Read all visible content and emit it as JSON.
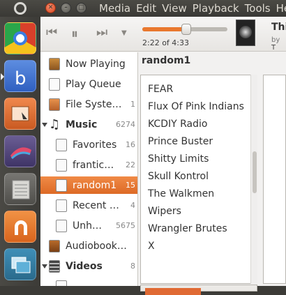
{
  "menu": [
    "Media",
    "Edit",
    "View",
    "Playback",
    "Tools",
    "Help"
  ],
  "player": {
    "time": "2:22 of 4:33",
    "progress": 0.52,
    "now_title": "Thi",
    "now_by_prefix": "by",
    "now_artist": "T"
  },
  "sidebar": [
    {
      "label": "Now Playing",
      "count": "",
      "icon": "now-playing-icon"
    },
    {
      "label": "Play Queue",
      "count": "",
      "icon": "play-queue-icon"
    },
    {
      "label": "File Syste…",
      "count": "1",
      "icon": "file-system-icon"
    },
    {
      "label": "Music",
      "count": "6274",
      "icon": "music-note-icon",
      "header": true
    },
    {
      "label": "Favorites",
      "count": "16",
      "icon": "smart-playlist-icon"
    },
    {
      "label": "frantic…",
      "count": "22",
      "icon": "playlist-icon"
    },
    {
      "label": "random1",
      "count": "15",
      "icon": "playlist-icon",
      "selected": true
    },
    {
      "label": "Recent …",
      "count": "4",
      "icon": "smart-playlist-icon"
    },
    {
      "label": "Unh…",
      "count": "5675",
      "icon": "smart-playlist-icon"
    },
    {
      "label": "Audiobook…",
      "count": "",
      "icon": "audiobook-icon"
    },
    {
      "label": "Videos",
      "count": "8",
      "icon": "video-icon",
      "header": true
    },
    {
      "label": "",
      "count": "",
      "icon": "smart-playlist-icon"
    }
  ],
  "playlist_title": "random1",
  "list": [
    "FEAR",
    "Flux Of Pink Indians",
    "KCDIY Radio",
    "Prince Buster",
    "Shitty Limits",
    "Skull Kontrol",
    "The Walkmen",
    "Wipers",
    "Wrangler Brutes",
    "X"
  ],
  "colors": {
    "accent": "#e9782e",
    "selection": "#e66f2c",
    "panel": "#3c3b37"
  }
}
